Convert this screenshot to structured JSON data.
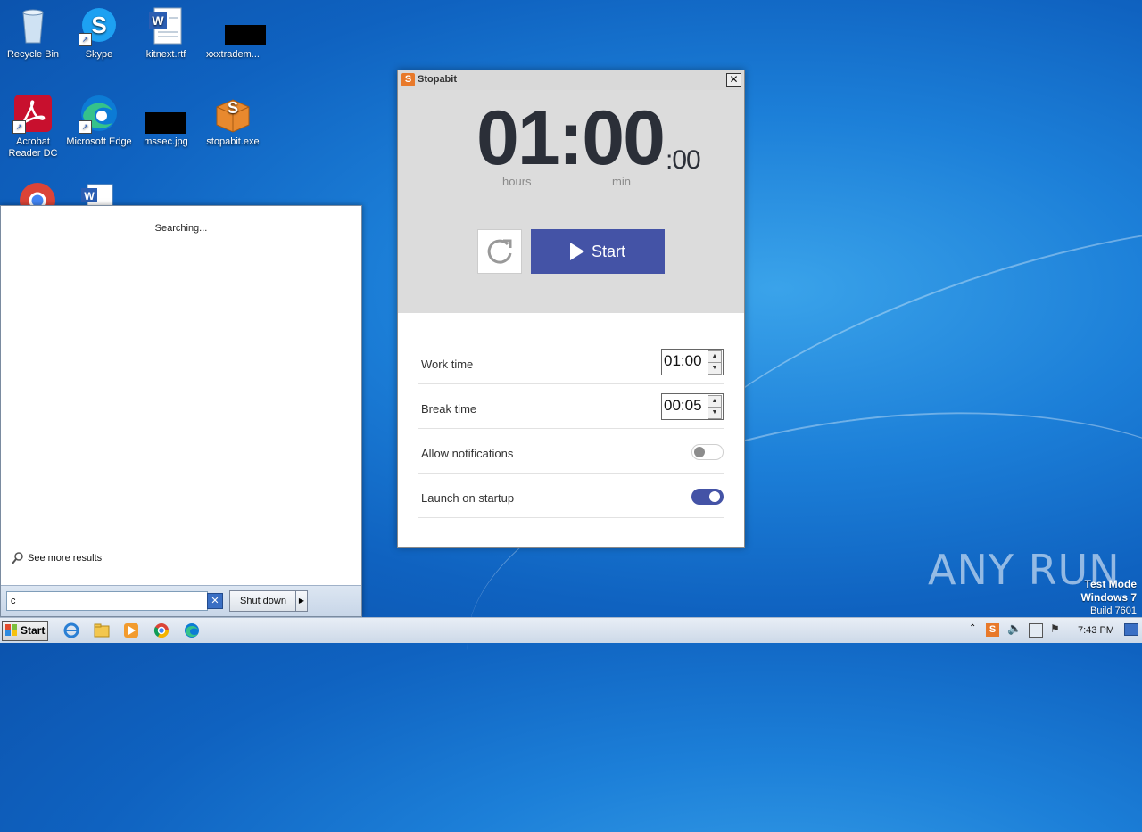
{
  "desktop": {
    "icons": [
      {
        "label": "Recycle Bin"
      },
      {
        "label": "Skype"
      },
      {
        "label": "kitnext.rtf"
      },
      {
        "label": "xxxtradem..."
      },
      {
        "label": "Acrobat Reader DC"
      },
      {
        "label": "Microsoft Edge"
      },
      {
        "label": "mssec.jpg"
      },
      {
        "label": "stopabit.exe"
      }
    ]
  },
  "start_menu": {
    "status": "Searching...",
    "see_more": "See more results",
    "search_value": "c",
    "shutdown_label": "Shut down"
  },
  "stopabit": {
    "title": "Stopabit",
    "timer_main": "01:00",
    "timer_seconds": ":00",
    "unit_hours": "hours",
    "unit_min": "min",
    "start_label": "Start",
    "work_time_label": "Work time",
    "work_time_value": "01:00",
    "break_time_label": "Break time",
    "break_time_value": "00:05",
    "allow_notifications_label": "Allow notifications",
    "allow_notifications_on": false,
    "launch_on_startup_label": "Launch on startup",
    "launch_on_startup_on": true,
    "accent_color": "#4453a6"
  },
  "taskbar": {
    "start_label": "Start",
    "clock": "7:43 PM"
  },
  "overlay": {
    "watermark": "ANY RUN",
    "test_mode": "Test Mode",
    "os_name": "Windows 7",
    "build": "Build 7601"
  }
}
